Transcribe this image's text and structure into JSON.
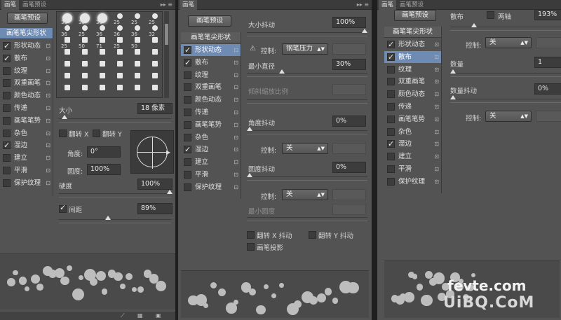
{
  "tabs": {
    "brush": "画笔",
    "presets": "画笔预设"
  },
  "tab_icons": "▸▸ ≡",
  "preset_button": "画笔预设",
  "tip_shape": "画笔笔尖形状",
  "list_items": [
    {
      "label": "形状动态",
      "checked": true
    },
    {
      "label": "散布",
      "checked": true
    },
    {
      "label": "纹理",
      "checked": false
    },
    {
      "label": "双重画笔",
      "checked": false
    },
    {
      "label": "颜色动态",
      "checked": false
    },
    {
      "label": "传递",
      "checked": false
    },
    {
      "label": "画笔笔势",
      "checked": false
    },
    {
      "label": "杂色",
      "checked": false
    },
    {
      "label": "湿边",
      "checked": true
    },
    {
      "label": "建立",
      "checked": false
    },
    {
      "label": "平滑",
      "checked": false
    },
    {
      "label": "保护纹理",
      "checked": false
    }
  ],
  "brush_sizes": [
    "30",
    "30",
    "30",
    "25",
    "25",
    "25",
    "36",
    "25",
    "36",
    "36",
    "36",
    "32",
    "25",
    "50",
    "71",
    "25",
    "50"
  ],
  "size_label": "大小",
  "size_value": "18 像素",
  "flip_x": "翻转 X",
  "flip_y": "翻转 Y",
  "angle_label": "角度:",
  "angle_value": "0°",
  "roundness_label": "圆度:",
  "roundness_value": "100%",
  "hardness_label": "硬度",
  "hardness_value": "100%",
  "spacing_label": "间距",
  "spacing_value": "89%",
  "footer_icons": [
    "⟋",
    "▦",
    "▣"
  ],
  "shape_dynamics": {
    "size_jitter_label": "大小抖动",
    "size_jitter_value": "100%",
    "control_label": "控制:",
    "control_size_value": "钢笔压力",
    "min_diameter_label": "最小直径",
    "min_diameter_value": "30%",
    "tilt_scale_label": "倾斜缩放比例",
    "angle_jitter_label": "角度抖动",
    "angle_jitter_value": "0%",
    "angle_control_value": "关",
    "roundness_jitter_label": "圆度抖动",
    "roundness_jitter_value": "0%",
    "roundness_control_value": "关",
    "min_roundness_label": "最小圆度",
    "flip_x_jitter": "翻转 X 抖动",
    "flip_y_jitter": "翻转 Y 抖动",
    "brush_projection": "画笔投影"
  },
  "scatter": {
    "scatter_label": "散布",
    "both_axes_label": "两轴",
    "scatter_value": "193%",
    "control_label": "控制:",
    "control_value": "关",
    "count_label": "数量",
    "count_value": "1",
    "count_jitter_label": "数量抖动",
    "count_jitter_value": "0%",
    "control2_value": "关"
  },
  "watermark": {
    "line1": "fevte.com",
    "line2": "UiBQ.CoM"
  }
}
